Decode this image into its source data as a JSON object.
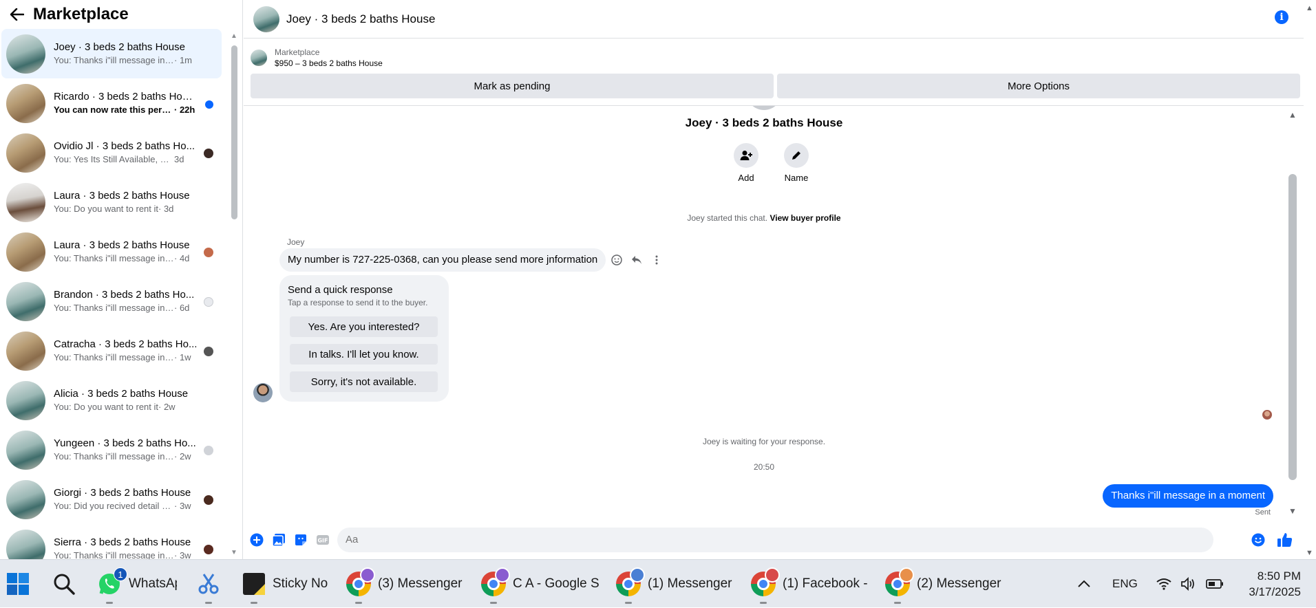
{
  "sidebar": {
    "title": "Marketplace",
    "conversations": [
      {
        "name": "Joey · 3 beds 2 baths House",
        "preview": "You: Thanks i\"ill message in a mo...",
        "time": " · 1m"
      },
      {
        "name": "Ricardo · 3 beds 2 baths House",
        "preview": "You can now rate this person",
        "time": " · 22h"
      },
      {
        "name": "Ovidio Jl · 3 beds 2 baths Ho...",
        "preview": "You: Yes Its Still Available, Pleas...",
        "time": " 3d"
      },
      {
        "name": "Laura · 3 beds 2 baths House",
        "preview": "You: Do you want to rent it",
        "time": " · 3d"
      },
      {
        "name": "Laura · 3 beds 2 baths House",
        "preview": "You: Thanks i\"ill message in a ...",
        "time": " · 4d"
      },
      {
        "name": "Brandon · 3 beds 2 baths Ho...",
        "preview": "You: Thanks i\"ill message in a ...",
        "time": " · 6d"
      },
      {
        "name": "Catracha · 3 beds 2 baths Ho...",
        "preview": "You: Thanks i\"ill message in a ...",
        "time": " · 1w"
      },
      {
        "name": "Alicia · 3 beds 2 baths House",
        "preview": "You: Do you want to rent it",
        "time": " · 2w"
      },
      {
        "name": "Yungeen · 3 beds 2 baths Ho...",
        "preview": "You: Thanks i\"ill message in a ...",
        "time": " · 2w"
      },
      {
        "name": "Giorgi · 3 beds 2 baths House",
        "preview": "You: Did you recived detail ple...",
        "time": " · 3w"
      },
      {
        "name": "Sierra · 3 beds 2 baths House",
        "preview": "You: Thanks i\"ill message in a ...",
        "time": " · 3w"
      }
    ]
  },
  "chat": {
    "title": "Joey · 3 beds 2 baths House",
    "listing_category": "Marketplace",
    "listing_price": "$950 – 3 beds 2 baths House",
    "mark_pending": "Mark as pending",
    "more_options": "More Options",
    "profile_name": "Joey · 3 beds 2 baths House",
    "add_label": "Add",
    "name_label": "Name",
    "started_text": "Joey started this chat.",
    "view_profile": "View buyer profile",
    "sender": "Joey",
    "incoming_message": "My number is 727-225-0368, can you please send more jnformation",
    "quick_title": "Send a quick response",
    "quick_sub": "Tap a response to send it to the buyer.",
    "quick_replies": [
      "Yes. Are you interested?",
      "In talks. I'll let you know.",
      "Sorry, it's not available."
    ],
    "waiting": "Joey is waiting for your response.",
    "timestamp": "20:50",
    "outgoing_message": "Thanks i\"ill message in a moment",
    "sent_label": "Sent",
    "composer_placeholder": "Aa"
  },
  "taskbar": {
    "whatsapp_label": "WhatsAp",
    "whatsapp_badge": "1",
    "sticky_label": "Sticky No",
    "chrome_windows": [
      {
        "label": "(3) Messenger",
        "profile_color": "#8a5cd0"
      },
      {
        "label": "C A - Google S",
        "profile_color": "#8a5cd0"
      },
      {
        "label": "(1) Messenger",
        "profile_color": "#4a7fd4"
      },
      {
        "label": "(1) Facebook -",
        "profile_color": "#d84a4a"
      },
      {
        "label": "(2) Messenger",
        "profile_color": "#e8904a"
      }
    ],
    "language": "ENG",
    "time": "8:50 PM",
    "date": "3/17/2025"
  },
  "colors": {
    "accent": "#0866ff",
    "active_bg": "#ebf4ff",
    "bubble_in": "#f0f2f5"
  }
}
